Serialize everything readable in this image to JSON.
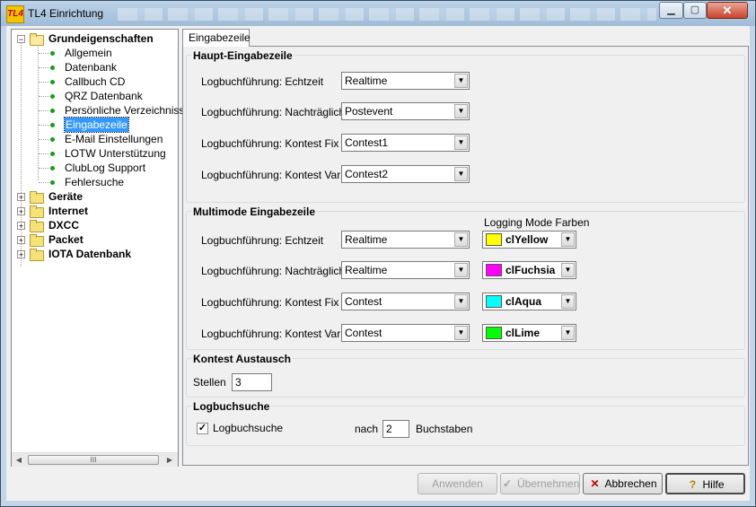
{
  "window": {
    "title": "TL4 Einrichtung",
    "icon_label": "TL4"
  },
  "tree": {
    "root": {
      "label": "Grundeigenschaften",
      "expander": "−"
    },
    "children": [
      "Allgemein",
      "Datenbank",
      "Callbuch CD",
      "QRZ Datenbank",
      "Persönliche Verzeichnisse.",
      "Eingabezeile",
      "E-Mail Einstellungen",
      "LOTW Unterstützung",
      "ClubLog Support",
      "Fehlersuche"
    ],
    "selected": "Eingabezeile",
    "collapsed": [
      "Geräte",
      "Internet",
      "DXCC",
      "Packet",
      "IOTA Datenbank"
    ],
    "scroll_thumb": "III"
  },
  "tab": {
    "label": "Eingabezeile"
  },
  "haupt": {
    "title": "Haupt-Eingabezeile",
    "rows": [
      {
        "label": "Logbuchführung: Echtzeit",
        "value": "Realtime"
      },
      {
        "label": "Logbuchführung: Nachträglich",
        "value": "Postevent"
      },
      {
        "label": "Logbuchführung: Kontest Fix",
        "value": "Contest1"
      },
      {
        "label": "Logbuchführung: Kontest Var",
        "value": "Contest2"
      }
    ]
  },
  "multimode": {
    "title": "Multimode Eingabezeile",
    "colors_header": "Logging Mode Farben",
    "rows": [
      {
        "label": "Logbuchführung: Echtzeit",
        "value": "Realtime",
        "color_name": "clYellow",
        "color": "#ffff00"
      },
      {
        "label": "Logbuchführung: Nachträglich",
        "value": "Realtime",
        "color_name": "clFuchsia",
        "color": "#ff00ff"
      },
      {
        "label": "Logbuchführung: Kontest Fix",
        "value": "Contest",
        "color_name": "clAqua",
        "color": "#00ffff"
      },
      {
        "label": "Logbuchführung: Kontest Var",
        "value": "Contest",
        "color_name": "clLime",
        "color": "#00ff00"
      }
    ]
  },
  "kontest": {
    "title": "Kontest Austausch",
    "stellen_label": "Stellen",
    "stellen_value": "3"
  },
  "logbuchsuche": {
    "title": "Logbuchsuche",
    "checkbox_label": "Logbuchsuche",
    "checked": true,
    "check_mark": "✓",
    "nach_label": "nach",
    "nach_value": "2",
    "suffix_label": "Buchstaben"
  },
  "buttons": {
    "anwenden": "Anwenden",
    "uebernehmen": "Übernehmen",
    "abbrechen": "Abbrechen",
    "hilfe": "Hilfe"
  },
  "colors": {
    "accent_selected": "#3399ff",
    "tree_dot": "#1a9a1a"
  }
}
